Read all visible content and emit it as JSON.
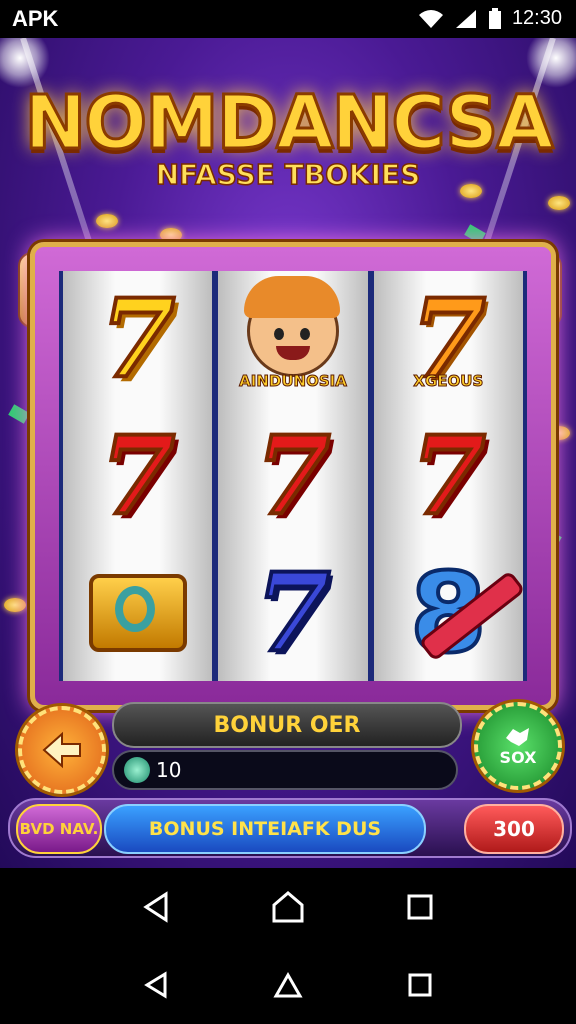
{
  "status_bar": {
    "app_label": "APK",
    "time": "12:30"
  },
  "game": {
    "title": "NOMDANCSA",
    "subtitle": "NFASSE TBOKIES",
    "reels": [
      [
        {
          "symbol": "seven",
          "color": "yellow",
          "text": "7"
        },
        {
          "symbol": "seven",
          "color": "red",
          "text": "7"
        },
        {
          "symbol": "drum-icon"
        }
      ],
      [
        {
          "symbol": "character",
          "label": "AINDUNOSIA"
        },
        {
          "symbol": "seven",
          "color": "red",
          "text": "7"
        },
        {
          "symbol": "seven",
          "color": "blue",
          "text": "7"
        }
      ],
      [
        {
          "symbol": "seven",
          "color": "orange",
          "text": "7",
          "label": "XGEOUS"
        },
        {
          "symbol": "seven",
          "color": "red",
          "text": "7"
        },
        {
          "symbol": "eight",
          "text": "8"
        }
      ]
    ],
    "bonus_label": "BONUR OER",
    "bet_value": "10",
    "right_button_label": "SOX",
    "left_pill_label": "BVD NAV.",
    "center_pill_label": "BONUS INTEIAFK DUS",
    "right_pill_label": "300"
  },
  "colors": {
    "title": "#ffd23a",
    "frame": "#e0b04a",
    "background": "#4a1a94"
  }
}
